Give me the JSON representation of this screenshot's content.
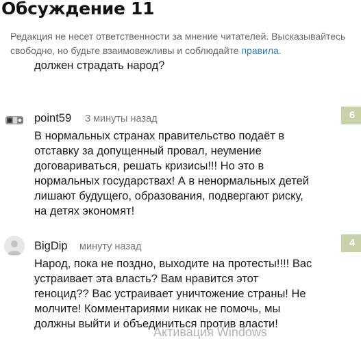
{
  "page": {
    "title": "Обсуждение 11",
    "disclaimer_text": "Редакция не несет ответственности за мнение читателей. Высказывайтесь свободно, но будьте взаимовежливы и соблюдайте ",
    "disclaimer_link": "правила",
    "disclaimer_end": "."
  },
  "comments": [
    {
      "text_cut": "должен страдать народ?"
    },
    {
      "author": "point59",
      "time": "3 минуты назад",
      "text": "В нормальных странах правительство подаёт в отставку за допущенный провал, неумение договариваться, решать кризисы!!! Но это в нормальных государствах! А в ненормальных детей лишают будущего, образования, подвергают риску, на детях экономят!",
      "rating": "6",
      "avatar_icon": "user-photo-icon"
    },
    {
      "author": "BigDip",
      "time": "минуту назад",
      "text": "Народ, пока не поздно, выходите на протесты!!!! Вас устраивает эта власть? Вам нравится этот геноцид?? Вас устраивает уничтожение страны! Не молчите! Комментариями никак не помочь, мы должны выйти и объединиться против власти!",
      "rating": "4",
      "avatar_icon": "default-user-icon"
    }
  ],
  "system": {
    "watermark": "Активация Windows"
  },
  "colors": {
    "rating_badge": "#c7d2a9",
    "link": "#2a7fc4",
    "muted": "#777777"
  }
}
